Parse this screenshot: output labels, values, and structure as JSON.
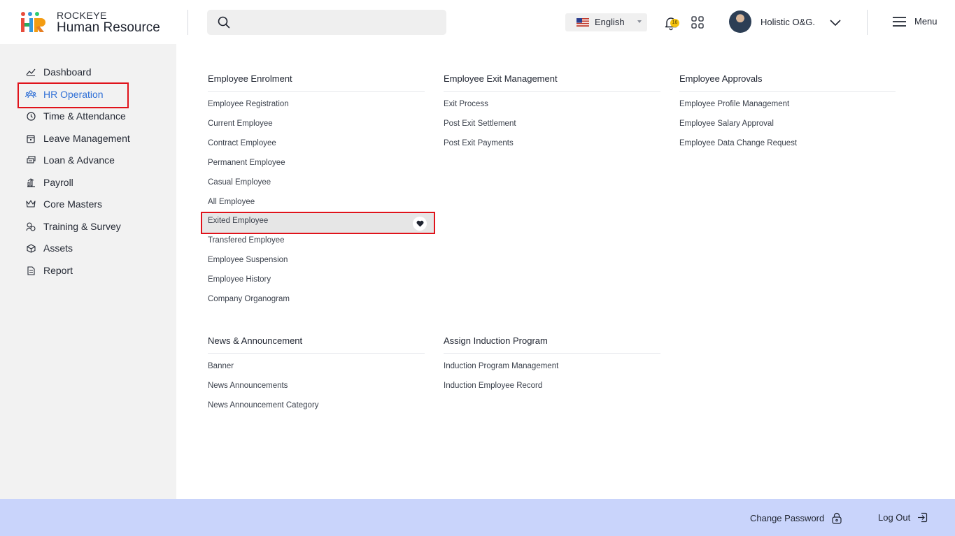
{
  "brand": {
    "top": "ROCKEYE",
    "main": "Human Resource"
  },
  "search": {
    "placeholder": "",
    "value": ""
  },
  "language": {
    "selected": "English"
  },
  "notifications": {
    "count": "16"
  },
  "user": {
    "name": "Holistic O&G."
  },
  "menu": {
    "label": "Menu"
  },
  "sidebar": {
    "items": [
      {
        "label": "Dashboard",
        "icon": "chart-line-icon"
      },
      {
        "label": "HR Operation",
        "icon": "people-network-icon",
        "active": true
      },
      {
        "label": "Time & Attendance",
        "icon": "clock-icon"
      },
      {
        "label": "Leave Management",
        "icon": "calendar-icon"
      },
      {
        "label": "Loan & Advance",
        "icon": "money-stack-icon"
      },
      {
        "label": "Payroll",
        "icon": "payroll-icon"
      },
      {
        "label": "Core Masters",
        "icon": "crown-icon"
      },
      {
        "label": "Training & Survey",
        "icon": "training-icon"
      },
      {
        "label": "Assets",
        "icon": "cube-icon"
      },
      {
        "label": "Report",
        "icon": "document-icon"
      }
    ]
  },
  "sections": {
    "enrolment": {
      "title": "Employee Enrolment",
      "links": [
        "Employee Registration",
        "Current Employee",
        "Contract Employee",
        "Permanent Employee",
        "Casual Employee",
        "All Employee",
        "Exited Employee",
        "Transfered Employee",
        "Employee Suspension",
        "Employee History",
        "Company Organogram"
      ]
    },
    "exit": {
      "title": "Employee Exit Management",
      "links": [
        "Exit Process",
        "Post Exit Settlement",
        "Post Exit Payments"
      ]
    },
    "approvals": {
      "title": "Employee Approvals",
      "links": [
        "Employee Profile Management",
        "Employee Salary Approval",
        "Employee Data Change Request"
      ]
    },
    "news": {
      "title": "News & Announcement",
      "links": [
        "Banner",
        "News Announcements",
        "News Announcement Category"
      ]
    },
    "induction": {
      "title": "Assign Induction Program",
      "links": [
        "Induction Program Management",
        "Induction Employee Record"
      ]
    }
  },
  "footer": {
    "change_password": "Change Password",
    "logout": "Log Out"
  },
  "colors": {
    "accent": "#2f6fd6",
    "highlight_border": "#e0131b",
    "footer_bg": "#c9d4fb",
    "sidebar_bg": "#f2f2f2"
  }
}
